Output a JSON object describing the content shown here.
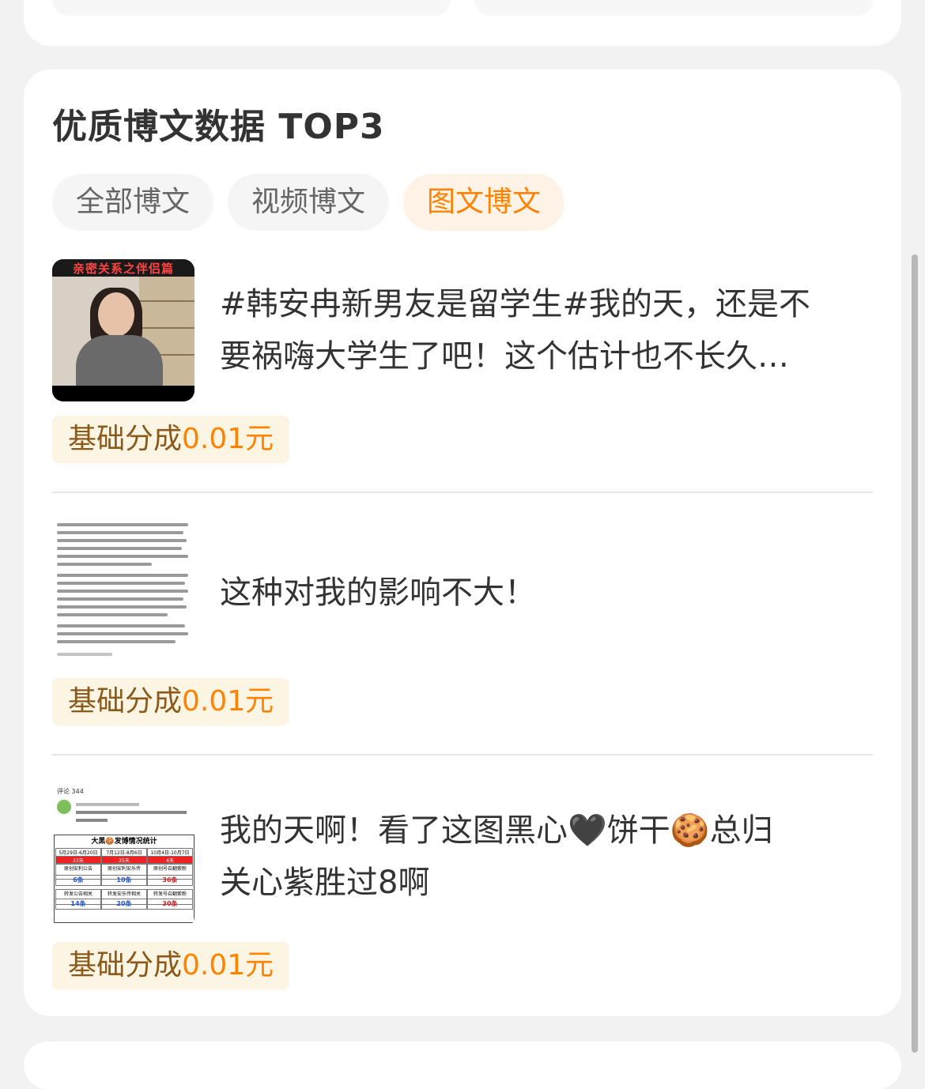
{
  "section": {
    "title": "优质博文数据 TOP3",
    "tabs": [
      {
        "label": "全部博文",
        "active": false
      },
      {
        "label": "视频博文",
        "active": false
      },
      {
        "label": "图文博文",
        "active": true
      }
    ]
  },
  "posts": [
    {
      "text_line1": "#韩安冉新男友是留学生#我的天，还是不",
      "text_line2": "要祸嗨大学生了吧！这个估计也不长久…",
      "thumb_banner": "亲密关系之伴侣篇",
      "badge_label": "基础分成",
      "badge_value": "0.01元"
    },
    {
      "text_line1": "这种对我的影响不大！",
      "text_line2": "",
      "badge_label": "基础分成",
      "badge_value": "0.01元"
    },
    {
      "text_line1": "我的天啊！看了这图黑心🖤饼干🍪总归",
      "text_line2": "关心紫胜过8啊",
      "thumb_header": "评论 344",
      "thumb_table_title": "大黑🍪发博情况统计",
      "thumb_dates": [
        "5月29日-6月20日",
        "7月12日-8月6日",
        "10月4日-10月7日"
      ],
      "thumb_days": [
        "22天",
        "25天",
        "4天"
      ],
      "thumb_row1": [
        "原创安利公告",
        "原创安利安乐传",
        "原创号召翻紫粉"
      ],
      "thumb_row1_vals": [
        "6条",
        "10条",
        "36条"
      ],
      "thumb_row2": [
        "转发公告相关",
        "转发安乐传相关",
        "转发号召翻紫粉"
      ],
      "thumb_row2_vals": [
        "14条",
        "20条",
        "30条"
      ],
      "badge_label": "基础分成",
      "badge_value": "0.01元"
    }
  ],
  "colors": {
    "accent": "#ff8200",
    "badge_bg": "#fdf5e3",
    "active_tab_bg": "#fff3e8"
  }
}
